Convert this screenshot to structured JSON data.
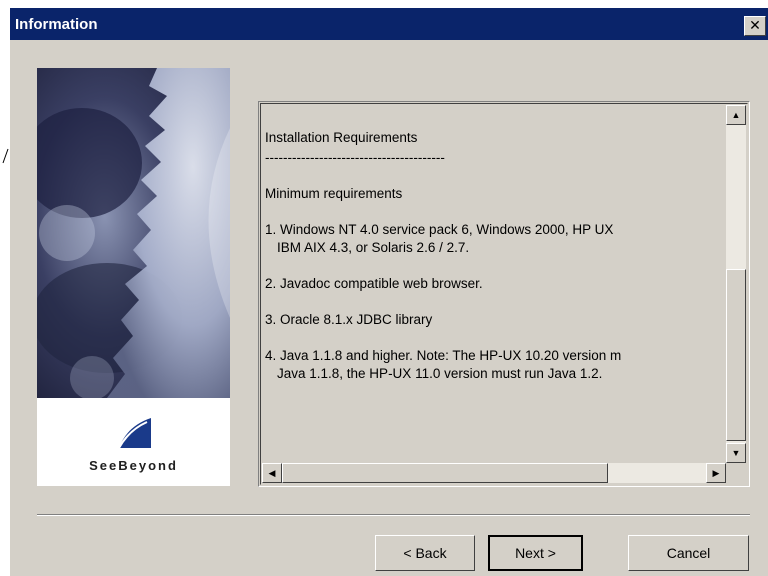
{
  "window": {
    "title": "Information",
    "close_glyph": "✕"
  },
  "side_image": {
    "logo_text": "SeeBeyond",
    "logo_icon": "seebeyond-logo"
  },
  "readme": {
    "heading": "Installation Requirements",
    "rule": "----------------------------------------",
    "subheading": "Minimum requirements",
    "item1_line1": "1. Windows NT 4.0 service pack 6, Windows 2000, HP UX",
    "item1_line2": "IBM AIX 4.3, or Solaris 2.6 / 2.7.",
    "item2": "2. Javadoc compatible web browser.",
    "item3": "3. Oracle 8.1.x JDBC library",
    "item4_line1": "4. Java 1.1.8 and higher.  Note: The HP-UX 10.20 version m",
    "item4_line2": "Java 1.1.8, the HP-UX 11.0 version must run Java 1.2."
  },
  "scrollbars": {
    "up_glyph": "▲",
    "down_glyph": "▼",
    "left_glyph": "◀",
    "right_glyph": "▶"
  },
  "buttons": {
    "back": "< Back",
    "next": "Next >",
    "cancel": "Cancel"
  },
  "colors": {
    "titlebar": "#0a246a",
    "dialog_face": "#d4d0c8"
  }
}
